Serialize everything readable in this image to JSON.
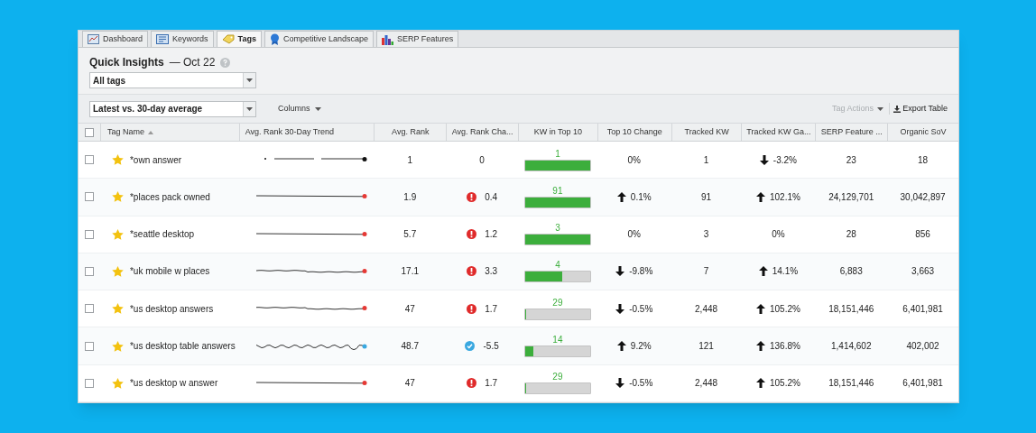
{
  "tabs": [
    {
      "label": "Dashboard",
      "kind": "dashboard",
      "selected": false
    },
    {
      "label": "Keywords",
      "kind": "keywords",
      "selected": false
    },
    {
      "label": "Tags",
      "kind": "tags",
      "selected": true
    },
    {
      "label": "Competitive Landscape",
      "kind": "ribbon",
      "selected": false
    },
    {
      "label": "SERP Features",
      "kind": "bars",
      "selected": false
    }
  ],
  "header": {
    "title": "Quick Insights",
    "date": "— Oct 22",
    "tag_filter": "All tags"
  },
  "toolbar": {
    "comparison": "Latest vs. 30-day average",
    "columns": "Columns",
    "tag_actions": {
      "label": "Tag Actions",
      "disabled": true
    },
    "export": "Export Table"
  },
  "table": {
    "select_all": {
      "checked": false
    },
    "columns": [
      "Tag Name",
      "Avg. Rank 30-Day Trend",
      "Avg. Rank",
      "Avg. Rank Cha...",
      "KW in Top 10",
      "Top 10 Change",
      "Tracked KW",
      "Tracked KW Ga...",
      "SERP Feature ...",
      "Organic SoV"
    ],
    "rows": [
      {
        "checked": false,
        "starred": true,
        "name": "*own answer",
        "kind": "gapped",
        "avg_rank": "1",
        "rank_change": {
          "kind": "none",
          "value": "0"
        },
        "top10": {
          "count": "1",
          "level": 1
        },
        "top10_change": {
          "kind": "none",
          "value": "0%"
        },
        "tracked": "1",
        "tracked_gain": {
          "kind": "down",
          "value": "-3.2%"
        },
        "serp": "23",
        "sov": "18"
      },
      {
        "checked": false,
        "starred": true,
        "name": "*places pack owned",
        "kind": "flat",
        "avg_rank": "1.9",
        "rank_change": {
          "kind": "alert",
          "value": "0.4"
        },
        "top10": {
          "count": "91",
          "level": 1
        },
        "top10_change": {
          "kind": "up",
          "value": "0.1%"
        },
        "tracked": "91",
        "tracked_gain": {
          "kind": "up",
          "value": "102.1%"
        },
        "serp": "24,129,701",
        "sov": "30,042,897"
      },
      {
        "checked": false,
        "starred": true,
        "name": "*seattle desktop",
        "kind": "flat",
        "avg_rank": "5.7",
        "rank_change": {
          "kind": "alert",
          "value": "1.2"
        },
        "top10": {
          "count": "3",
          "level": 1
        },
        "top10_change": {
          "kind": "none",
          "value": "0%"
        },
        "tracked": "3",
        "tracked_gain": {
          "kind": "none",
          "value": "0%"
        },
        "serp": "28",
        "sov": "856"
      },
      {
        "checked": false,
        "starred": true,
        "name": "*uk mobile w places",
        "kind": "dip",
        "avg_rank": "17.1",
        "rank_change": {
          "kind": "alert",
          "value": "3.3"
        },
        "top10": {
          "count": "4",
          "level": 0.57
        },
        "top10_change": {
          "kind": "down",
          "value": "-9.8%"
        },
        "tracked": "7",
        "tracked_gain": {
          "kind": "up",
          "value": "14.1%"
        },
        "serp": "6,883",
        "sov": "3,663"
      },
      {
        "checked": false,
        "starred": true,
        "name": "*us desktop answers",
        "kind": "dip",
        "avg_rank": "47",
        "rank_change": {
          "kind": "alert",
          "value": "1.7"
        },
        "top10": {
          "count": "29",
          "level": 0.01
        },
        "top10_change": {
          "kind": "down",
          "value": "-0.5%"
        },
        "tracked": "2,448",
        "tracked_gain": {
          "kind": "up",
          "value": "105.2%"
        },
        "serp": "18,151,446",
        "sov": "6,401,981"
      },
      {
        "checked": false,
        "starred": true,
        "name": "*us desktop table answers",
        "kind": "wavy",
        "avg_rank": "48.7",
        "rank_change": {
          "kind": "good",
          "value": "-5.5"
        },
        "top10": {
          "count": "14",
          "level": 0.12
        },
        "top10_change": {
          "kind": "up",
          "value": "9.2%"
        },
        "tracked": "121",
        "tracked_gain": {
          "kind": "up",
          "value": "136.8%"
        },
        "serp": "1,414,602",
        "sov": "402,002"
      },
      {
        "checked": false,
        "starred": true,
        "name": "*us desktop w answer",
        "kind": "flat",
        "avg_rank": "47",
        "rank_change": {
          "kind": "alert",
          "value": "1.7"
        },
        "top10": {
          "count": "29",
          "level": 0.01
        },
        "top10_change": {
          "kind": "down",
          "value": "-0.5%"
        },
        "tracked": "2,448",
        "tracked_gain": {
          "kind": "up",
          "value": "105.2%"
        },
        "serp": "18,151,446",
        "sov": "6,401,981"
      }
    ]
  }
}
